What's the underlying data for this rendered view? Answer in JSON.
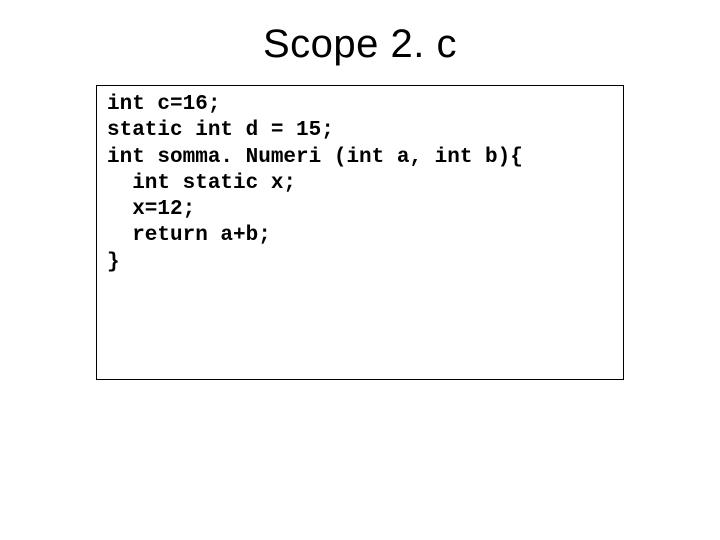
{
  "title": "Scope 2. c",
  "code": "int c=16;\nstatic int d = 15;\nint somma. Numeri (int a, int b){\n  int static x;\n  x=12;\n  return a+b;\n}"
}
